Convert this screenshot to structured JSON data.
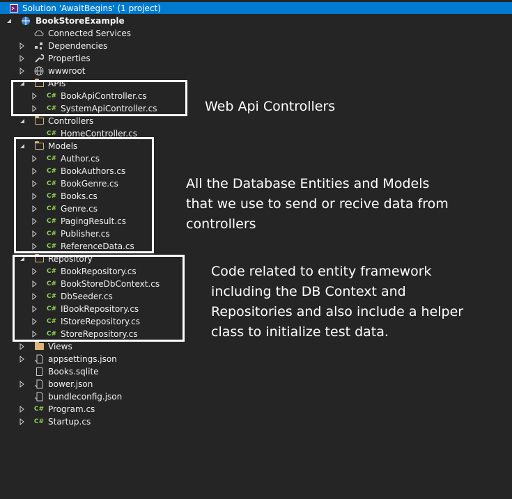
{
  "solution": {
    "label": "Solution 'AwaitBegins' (1 project)"
  },
  "tree": {
    "project": "BookStoreExample",
    "connected_services": "Connected Services",
    "dependencies": "Dependencies",
    "properties": "Properties",
    "wwwroot": "wwwroot",
    "apis": {
      "label": "APIs",
      "items": [
        "BookApiController.cs",
        "SystemApiController.cs"
      ]
    },
    "controllers": {
      "label": "Controllers",
      "items": [
        "HomeController.cs"
      ]
    },
    "models": {
      "label": "Models",
      "items": [
        "Author.cs",
        "BookAuthors.cs",
        "BookGenre.cs",
        "Books.cs",
        "Genre.cs",
        "PagingResult.cs",
        "Publisher.cs",
        "ReferenceData.cs"
      ]
    },
    "repository": {
      "label": "Repository",
      "items": [
        "BookRepository.cs",
        "BookStoreDbContext.cs",
        "DbSeeder.cs",
        "IBookRepository.cs",
        "IStoreRepository.cs",
        "StoreRepository.cs"
      ]
    },
    "views": "Views",
    "appsettings": "appsettings.json",
    "books_sqlite": "Books.sqlite",
    "bower": "bower.json",
    "bundleconfig": "bundleconfig.json",
    "program": "Program.cs",
    "startup": "Startup.cs",
    "cs_badge": "C#"
  },
  "notes": {
    "apis": "Web Api Controllers",
    "models": [
      "All the Database Entities and Models",
      "that we use to send or recive data from",
      "controllers"
    ],
    "repository": [
      "Code related to entity framework",
      "including the DB Context and",
      "Repositories and also include a helper",
      "class to initialize test data."
    ]
  },
  "colors": {
    "background": "#252526",
    "solution_bar": "#007acc",
    "cs_icon": "#8fd14f",
    "folder": "#dcb67a"
  }
}
